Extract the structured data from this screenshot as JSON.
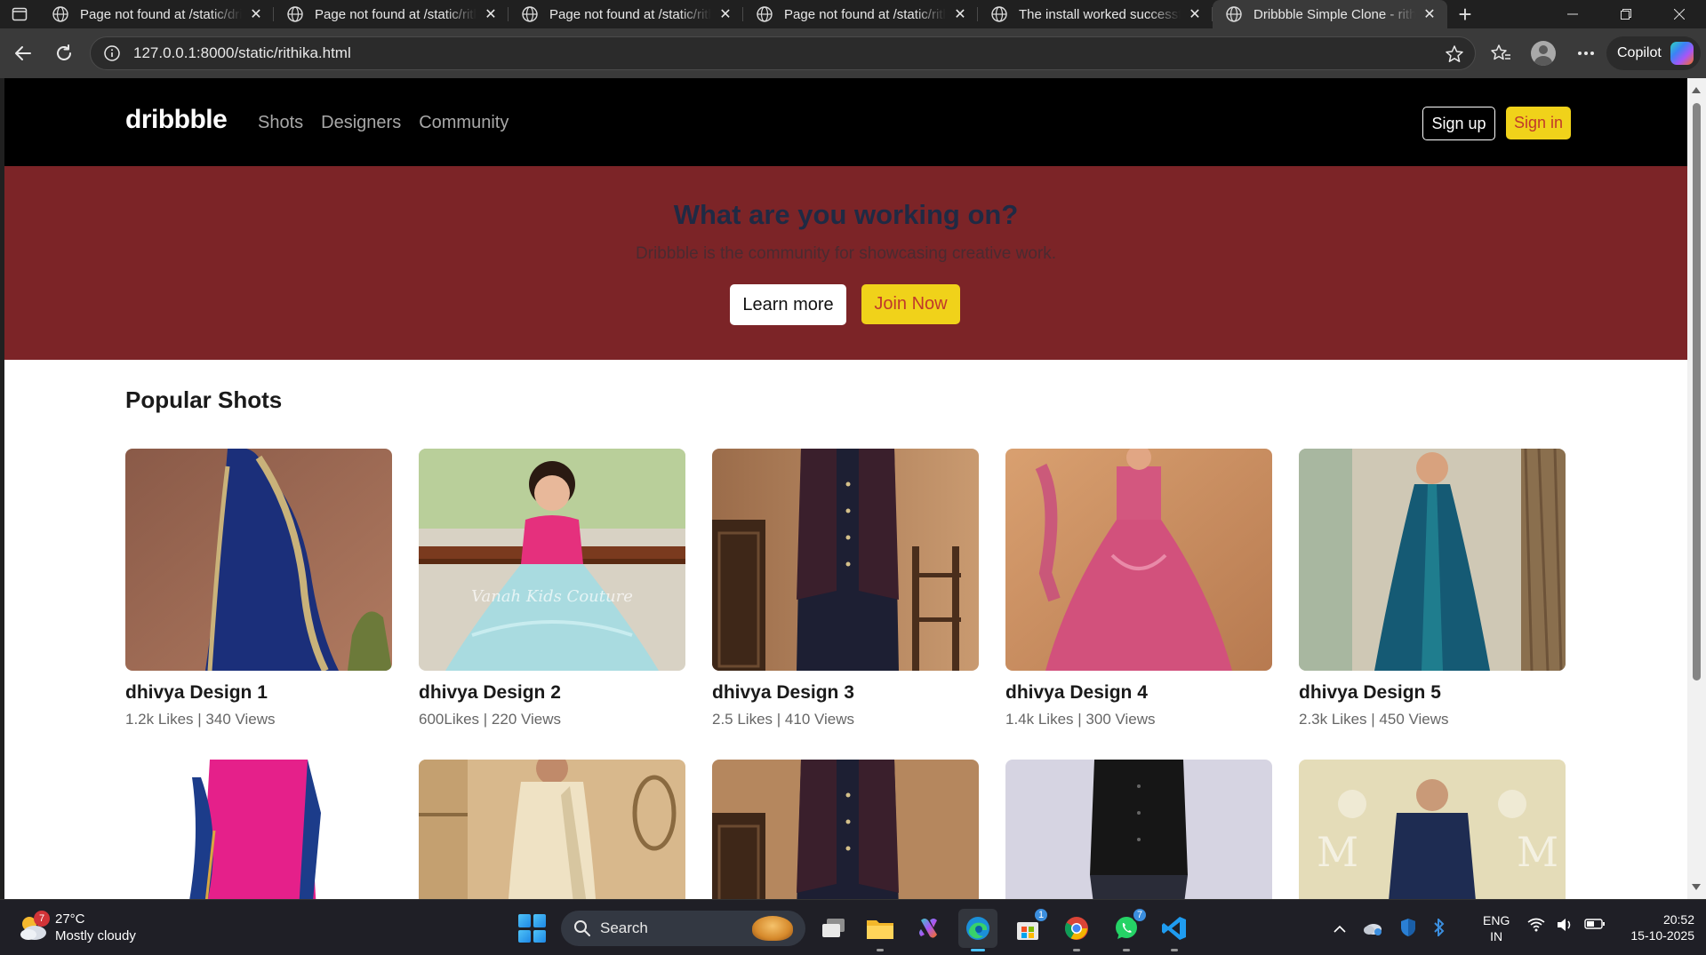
{
  "browser": {
    "tabs": [
      {
        "title": "Page not found at /static/dribbble",
        "active": false
      },
      {
        "title": "Page not found at /static/rithika",
        "active": false
      },
      {
        "title": "Page not found at /static/rithika",
        "active": false
      },
      {
        "title": "Page not found at /static/rithika",
        "active": false
      },
      {
        "title": "The install worked successfully",
        "active": false
      },
      {
        "title": "Dribbble Simple Clone - rithika",
        "active": true
      }
    ],
    "url": "127.0.0.1:8000/static/rithika.html",
    "copilot_label": "Copilot"
  },
  "site": {
    "logo": "dribbble",
    "nav": [
      "Shots",
      "Designers",
      "Community"
    ],
    "signup": "Sign up",
    "signin": "Sign in",
    "hero": {
      "title": "What are you working on?",
      "subtitle": "Dribbble is the community for showcasing creative work.",
      "learn_more": "Learn more",
      "join_now": "Join Now"
    },
    "section_title": "Popular Shots",
    "shots": [
      {
        "title": "dhivya Design 1",
        "stats": "1.2k Likes | 340 Views"
      },
      {
        "title": "dhivya Design 2",
        "stats": "600Likes | 220 Views"
      },
      {
        "title": "dhivya Design 3",
        "stats": "2.5 Likes | 410 Views"
      },
      {
        "title": "dhivya Design 4",
        "stats": "1.4k Likes | 300 Views"
      },
      {
        "title": "dhivya Design 5",
        "stats": "2.3k Likes | 450 Views"
      }
    ],
    "thumb_watermark": "Vanah Kids Couture"
  },
  "taskbar": {
    "weather_temp": "27°C",
    "weather_desc": "Mostly cloudy",
    "weather_badge": "7",
    "search_label": "Search",
    "store_badge": "1",
    "whatsapp_badge": "7",
    "lang_top": "ENG",
    "lang_bottom": "IN",
    "time": "20:52",
    "date": "15-10-2025"
  },
  "colors": {
    "hero_bg": "#7c2427",
    "accent_yellow": "#f0d21a",
    "accent_red_text": "#c0392b",
    "nav_bg": "#000000"
  }
}
